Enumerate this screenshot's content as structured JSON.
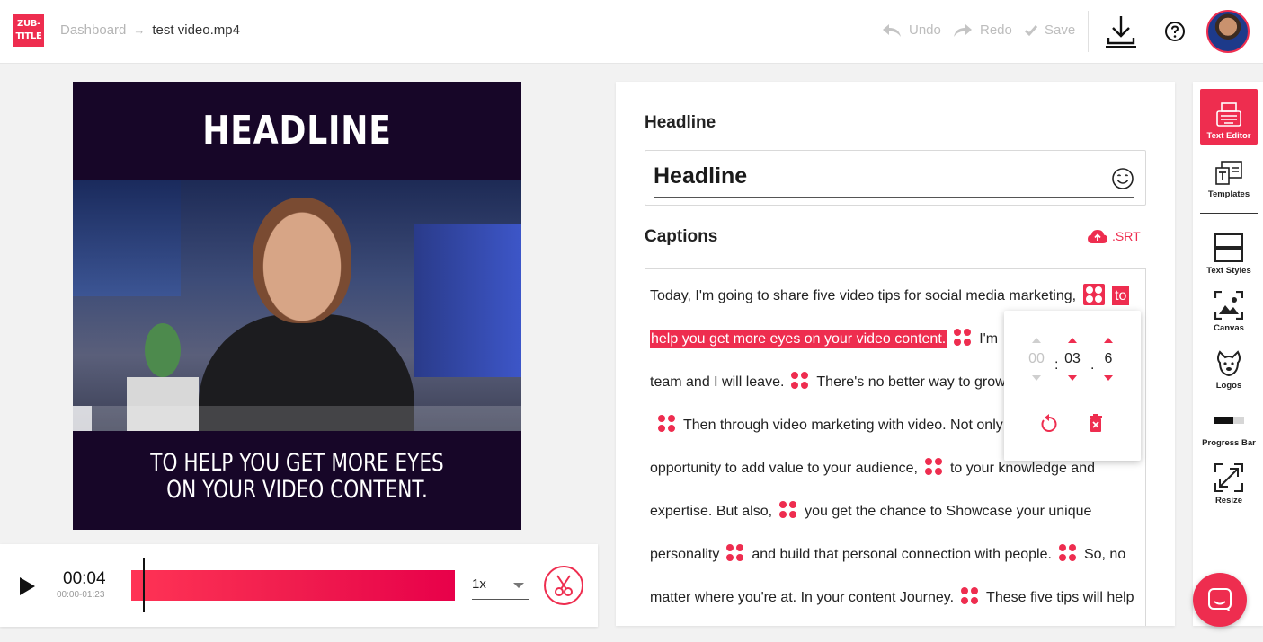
{
  "header": {
    "logo_text_1": "ZUB-",
    "logo_text_2": "TITLE",
    "breadcrumb_root": "Dashboard",
    "breadcrumb_arrow": "→",
    "breadcrumb_file": "test video.mp4",
    "undo_label": "Undo",
    "redo_label": "Redo",
    "save_label": "Save"
  },
  "preview": {
    "headline": "HEADLINE",
    "caption_line_1": "TO HELP YOU GET MORE EYES",
    "caption_line_2": "ON YOUR VIDEO CONTENT."
  },
  "player": {
    "current_time": "00:04",
    "range": "00:00-01:23",
    "speed": "1x"
  },
  "editor": {
    "headline_title": "Headline",
    "headline_value": "Headline",
    "captions_title": "Captions",
    "srt_label": ".SRT",
    "captions": {
      "s1": "Today, I'm going to share five video tips for social media marketing,",
      "s2a": "to",
      "s2b": "help you get more eyes on your video content.",
      "s3a": "I'm",
      "s3b": "team and I will leave.",
      "s4": "There's no better way to grow",
      "s5": "Then through video marketing with video. Not only",
      "s5b": "opportunity to add value to your audience,",
      "s6": "to your knowledge and",
      "s6b": "expertise. But also,",
      "s7": "you get the chance to Showcase your unique",
      "s7b": "personality",
      "s8": "and build that personal connection with people.",
      "s9": "So, no",
      "s9b": "matter where you're at. In your content Journey.",
      "s10": "These five tips will help"
    },
    "time_popover": {
      "minutes": "00",
      "seconds": "03",
      "tenths": "6",
      "colon": ":",
      "dot": "."
    }
  },
  "tools": [
    {
      "label": "Text Editor",
      "icon": "typewriter-icon",
      "active": true
    },
    {
      "label": "Templates",
      "icon": "templates-icon",
      "active": false
    },
    {
      "label": "Text Styles",
      "icon": "text-styles-icon",
      "active": false
    },
    {
      "label": "Canvas",
      "icon": "canvas-icon",
      "active": false
    },
    {
      "label": "Logos",
      "icon": "dog-icon",
      "active": false
    },
    {
      "label": "Progress Bar",
      "icon": "progress-bar-icon",
      "active": false
    },
    {
      "label": "Resize",
      "icon": "resize-icon",
      "active": false
    }
  ],
  "colors": {
    "accent": "#ee2d4f",
    "video_bg": "#170628"
  }
}
